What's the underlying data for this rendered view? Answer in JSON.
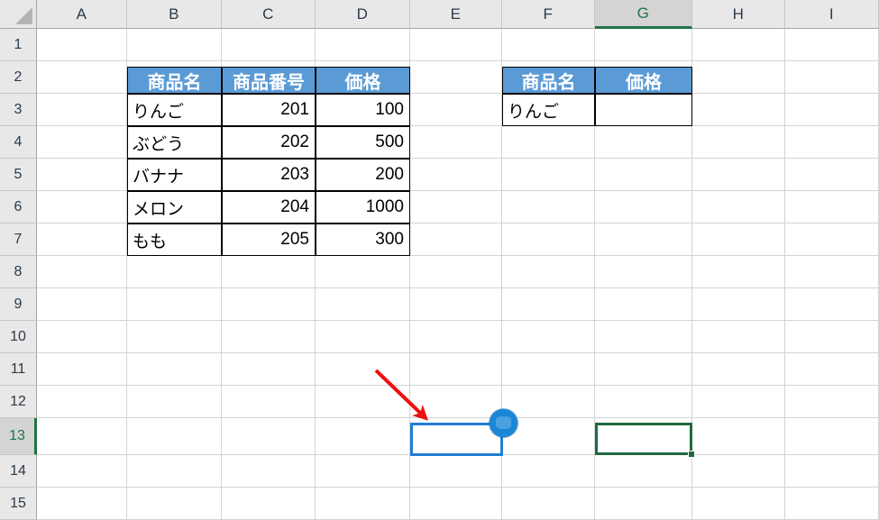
{
  "app": {
    "type": "spreadsheet",
    "accent_green": "#217346",
    "header_fill": "#5b9bd5",
    "annotation_blue": "#1f7fd4",
    "arrow_red": "#ee1111"
  },
  "grid": {
    "columns": [
      "A",
      "B",
      "C",
      "D",
      "E",
      "F",
      "G",
      "H",
      "I"
    ],
    "rows": [
      "1",
      "2",
      "3",
      "4",
      "5",
      "6",
      "7",
      "8",
      "9",
      "10",
      "11",
      "12",
      "13",
      "14",
      "15"
    ],
    "active_column": "G",
    "active_row": "13",
    "active_cell": "G13"
  },
  "source_table": {
    "headers": [
      "商品名",
      "商品番号",
      "価格"
    ],
    "rows": [
      {
        "name": "りんご",
        "number": "201",
        "price": "100"
      },
      {
        "name": "ぶどう",
        "number": "202",
        "price": "500"
      },
      {
        "name": "バナナ",
        "number": "203",
        "price": "200"
      },
      {
        "name": "メロン",
        "number": "204",
        "price": "1000"
      },
      {
        "name": "もも",
        "number": "205",
        "price": "300"
      }
    ]
  },
  "lookup_table": {
    "headers": [
      "商品名",
      "価格"
    ],
    "rows": [
      {
        "name": "りんご",
        "price": ""
      }
    ]
  },
  "annotations": {
    "highlight_cell": "E13",
    "cursor_label": "mouse-cursor",
    "arrow_label": "red-pointer-arrow"
  }
}
